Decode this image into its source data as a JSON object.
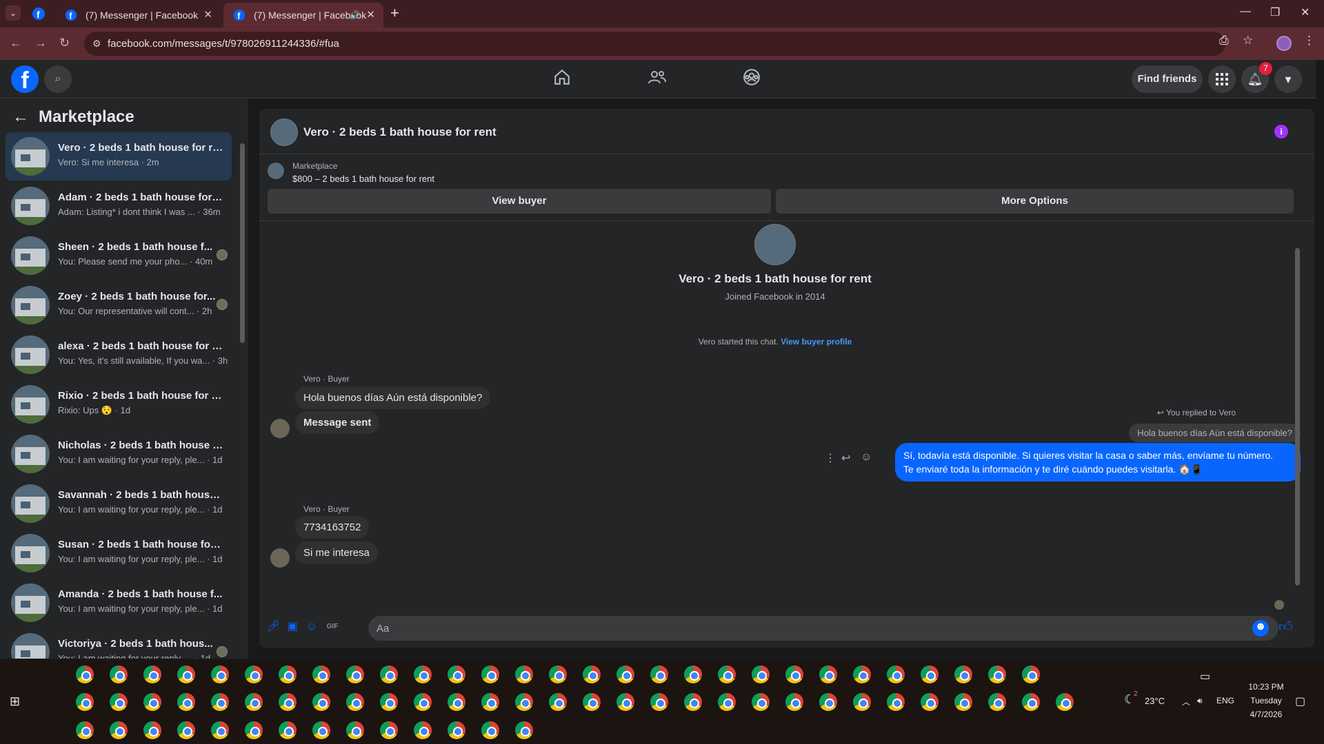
{
  "browser": {
    "tabs": [
      {
        "title": "(7) Messenger | Facebook"
      },
      {
        "title": "(7) Messenger | Facebook"
      }
    ],
    "url": "facebook.com/messages/t/978026911244336/#fua"
  },
  "fb_header": {
    "find_friends_label": "Find friends",
    "notification_count": "7",
    "icons": [
      "facebook-logo",
      "search-icon",
      "home-icon",
      "friends-icon",
      "groups-icon",
      "apps-grid-icon",
      "bell-icon",
      "chevron-down-icon"
    ]
  },
  "sidebar": {
    "title": "Marketplace",
    "conversations": [
      {
        "name": "Vero · 2 beds 1 bath house for re...",
        "snippet": "Vero: Si me interesa · 2m",
        "active": true
      },
      {
        "name": "Adam · 2 beds 1 bath house for r...",
        "snippet": "Adam: Listing* i dont think I was ... · 36m"
      },
      {
        "name": "Sheen · 2 beds 1 bath house f...",
        "snippet": "You: Please send me your pho... · 40m"
      },
      {
        "name": "Zoey · 2 beds 1 bath house for...",
        "snippet": "You: Our representative will cont... · 2h"
      },
      {
        "name": "alexa · 2 beds 1 bath house for r...",
        "snippet": "You: Yes, it's still available, If you wa... · 3h"
      },
      {
        "name": "Rixio · 2 beds 1 bath house for r...",
        "snippet": "Rixio: Ups 😯 · 1d"
      },
      {
        "name": "Nicholas · 2 beds 1 bath house f...",
        "snippet": "You: I am waiting for your reply, ple... · 1d"
      },
      {
        "name": "Savannah · 2 beds 1 bath house ...",
        "snippet": "You: I am waiting for your reply, ple... · 1d"
      },
      {
        "name": "Susan · 2 beds 1 bath house for r...",
        "snippet": "You: I am waiting for your reply, ple... · 1d"
      },
      {
        "name": "Amanda · 2 beds 1 bath house f...",
        "snippet": "You: I am waiting for your reply, ple... · 1d"
      },
      {
        "name": "Victoriya · 2 beds 1 bath hous...",
        "snippet": "You: I am waiting for your reply, ... · 1d"
      }
    ]
  },
  "chat": {
    "title": "Vero · 2 beds 1 bath house for rent",
    "marketplace_label": "Marketplace",
    "listing": "$800 – 2 beds 1 bath house for rent",
    "view_buyer_label": "View buyer",
    "more_options_label": "More Options",
    "profile_name": "Vero · 2 beds 1 bath house for rent",
    "joined": "Joined Facebook in 2014",
    "started_text": "Vero started this chat.",
    "started_link": "View buyer profile",
    "sender_label": "Vero · Buyer",
    "msg1": "Hola buenos días Aún está disponible?",
    "msg2": "Message sent",
    "replied_label": "You replied to Vero",
    "quoted": "Hola buenos días Aún está disponible?",
    "reply_line1": "Sí, todavía está disponible. Si quieres visitar la casa o saber más, envíame tu número.",
    "reply_line2": "Te enviaré toda la información y te diré cuándo puedes visitarla. 🏠📱",
    "sender_label2": "Vero · Buyer",
    "msg3": "7734163752",
    "msg4": "Si me interesa",
    "input_placeholder": "Aa"
  },
  "taskbar": {
    "weather": "23°C",
    "weather_badge": "2",
    "lang": "ENG",
    "time": "10:23 PM",
    "day": "Tuesday",
    "date": "4/7/2026"
  }
}
